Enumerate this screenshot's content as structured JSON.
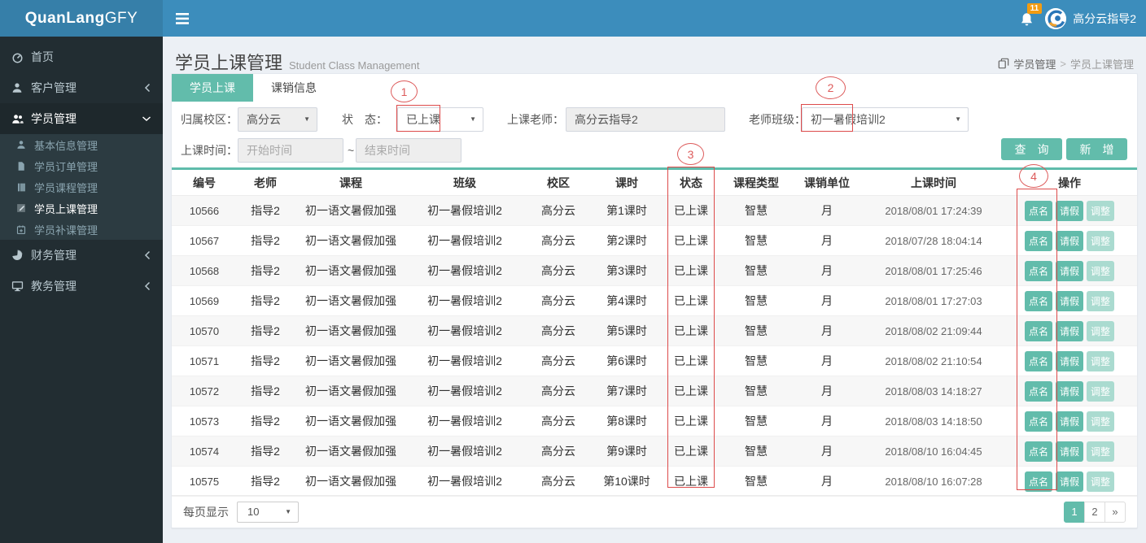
{
  "brand": {
    "name_bold": "QuanLang",
    "name_light": "GFY"
  },
  "navbar": {
    "notification_count": "11",
    "username": "高分云指导2"
  },
  "sidebar": {
    "items": [
      {
        "label": "首页"
      },
      {
        "label": "客户管理"
      },
      {
        "label": "学员管理"
      },
      {
        "label": "基本信息管理"
      },
      {
        "label": "学员订单管理"
      },
      {
        "label": "学员课程管理"
      },
      {
        "label": "学员上课管理"
      },
      {
        "label": "学员补课管理"
      },
      {
        "label": "财务管理"
      },
      {
        "label": "教务管理"
      }
    ]
  },
  "header": {
    "title": "学员上课管理",
    "subtitle": "Student Class Management",
    "breadcrumb_parent": "学员管理",
    "breadcrumb_sep": ">",
    "breadcrumb_current": "学员上课管理"
  },
  "tabs": {
    "active": "学员上课",
    "inactive": "课销信息"
  },
  "filters": {
    "campus_label": "归属校区：",
    "campus_value": "高分云",
    "status_label": "状　态：",
    "status_value": "已上课",
    "teacher_label": "上课老师：",
    "teacher_value": "高分云指导2",
    "class_label": "老师班级：",
    "class_value": "初一暑假培训2",
    "time_label": "上课时间：",
    "start_placeholder": "开始时间",
    "tilde": "~",
    "end_placeholder": "结束时间",
    "search_button": "查　询",
    "add_button": "新　增"
  },
  "table": {
    "headers": [
      "编号",
      "老师",
      "课程",
      "班级",
      "校区",
      "课时",
      "状态",
      "课程类型",
      "课销单位",
      "上课时间",
      "操作"
    ],
    "action_labels": [
      "点名",
      "请假",
      "调整"
    ],
    "rows": [
      {
        "id": "10566",
        "teacher": "指导2",
        "course": "初一语文暑假加强",
        "class": "初一暑假培训2",
        "campus": "高分云",
        "lesson": "第1课时",
        "status": "已上课",
        "type": "智慧",
        "unit": "月",
        "time": "2018/08/01 17:24:39"
      },
      {
        "id": "10567",
        "teacher": "指导2",
        "course": "初一语文暑假加强",
        "class": "初一暑假培训2",
        "campus": "高分云",
        "lesson": "第2课时",
        "status": "已上课",
        "type": "智慧",
        "unit": "月",
        "time": "2018/07/28 18:04:14"
      },
      {
        "id": "10568",
        "teacher": "指导2",
        "course": "初一语文暑假加强",
        "class": "初一暑假培训2",
        "campus": "高分云",
        "lesson": "第3课时",
        "status": "已上课",
        "type": "智慧",
        "unit": "月",
        "time": "2018/08/01 17:25:46"
      },
      {
        "id": "10569",
        "teacher": "指导2",
        "course": "初一语文暑假加强",
        "class": "初一暑假培训2",
        "campus": "高分云",
        "lesson": "第4课时",
        "status": "已上课",
        "type": "智慧",
        "unit": "月",
        "time": "2018/08/01 17:27:03"
      },
      {
        "id": "10570",
        "teacher": "指导2",
        "course": "初一语文暑假加强",
        "class": "初一暑假培训2",
        "campus": "高分云",
        "lesson": "第5课时",
        "status": "已上课",
        "type": "智慧",
        "unit": "月",
        "time": "2018/08/02 21:09:44"
      },
      {
        "id": "10571",
        "teacher": "指导2",
        "course": "初一语文暑假加强",
        "class": "初一暑假培训2",
        "campus": "高分云",
        "lesson": "第6课时",
        "status": "已上课",
        "type": "智慧",
        "unit": "月",
        "time": "2018/08/02 21:10:54"
      },
      {
        "id": "10572",
        "teacher": "指导2",
        "course": "初一语文暑假加强",
        "class": "初一暑假培训2",
        "campus": "高分云",
        "lesson": "第7课时",
        "status": "已上课",
        "type": "智慧",
        "unit": "月",
        "time": "2018/08/03 14:18:27"
      },
      {
        "id": "10573",
        "teacher": "指导2",
        "course": "初一语文暑假加强",
        "class": "初一暑假培训2",
        "campus": "高分云",
        "lesson": "第8课时",
        "status": "已上课",
        "type": "智慧",
        "unit": "月",
        "time": "2018/08/03 14:18:50"
      },
      {
        "id": "10574",
        "teacher": "指导2",
        "course": "初一语文暑假加强",
        "class": "初一暑假培训2",
        "campus": "高分云",
        "lesson": "第9课时",
        "status": "已上课",
        "type": "智慧",
        "unit": "月",
        "time": "2018/08/10 16:04:45"
      },
      {
        "id": "10575",
        "teacher": "指导2",
        "course": "初一语文暑假加强",
        "class": "初一暑假培训2",
        "campus": "高分云",
        "lesson": "第10课时",
        "status": "已上课",
        "type": "智慧",
        "unit": "月",
        "time": "2018/08/10 16:07:28"
      }
    ]
  },
  "footer": {
    "per_page_label": "每页显示",
    "per_page_value": "10",
    "pages": [
      "1",
      "2",
      "»"
    ]
  },
  "annotations": {
    "n1": "1",
    "n2": "2",
    "n3": "3",
    "n4": "4"
  },
  "colors": {
    "teal": "#62bcab",
    "navbar_blue": "#3c8dbc",
    "logo_blue": "#367fa9",
    "sidebar_dark": "#222d32",
    "annotation_red": "#dd5b5b",
    "badge_orange": "#f39c12"
  }
}
